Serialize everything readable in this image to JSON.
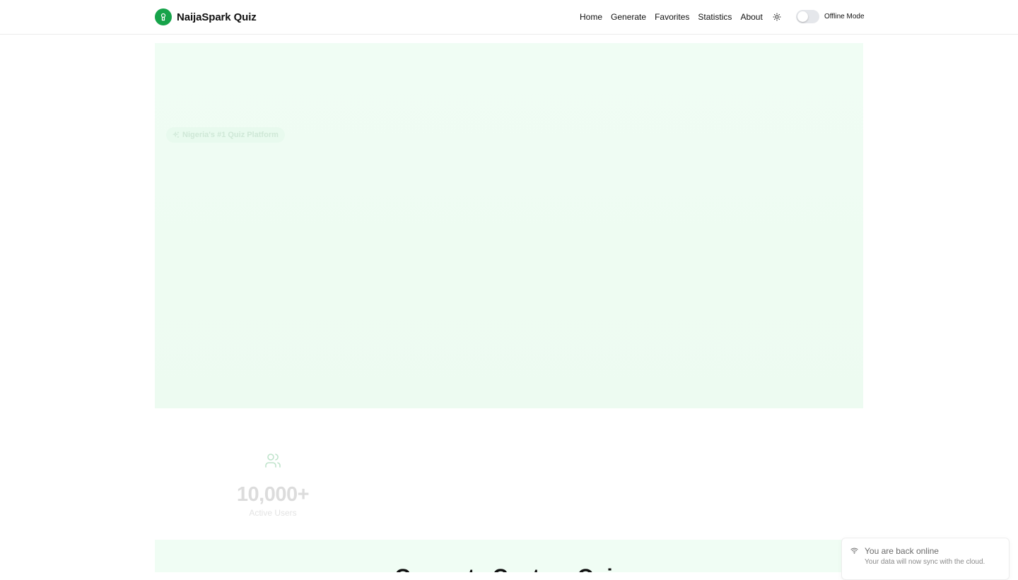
{
  "navbar": {
    "brand": {
      "name": "NaijaSpark Quiz",
      "logo_icon": "quiz-logo-icon"
    },
    "links": [
      "Home",
      "Generate",
      "Favorites",
      "Statistics",
      "About"
    ],
    "theme_toggle_icon": "sun-icon",
    "offline_mode": {
      "label": "Offline Mode",
      "enabled": false
    }
  },
  "hero": {
    "badge": {
      "icon": "sparkles-icon",
      "text": "Nigeria's #1 Quiz Platform"
    }
  },
  "stats": {
    "users": {
      "icon": "users-icon",
      "value": "10,000+",
      "label": "Active Users"
    }
  },
  "generate_section": {
    "title": "Generate Custom Quiz"
  },
  "toast": {
    "icon": "wifi-icon",
    "title": "You are back online",
    "description": "Your data will now sync with the cloud."
  },
  "colors": {
    "brand": "#16a34a",
    "hero_background": "#f0fdf4"
  }
}
